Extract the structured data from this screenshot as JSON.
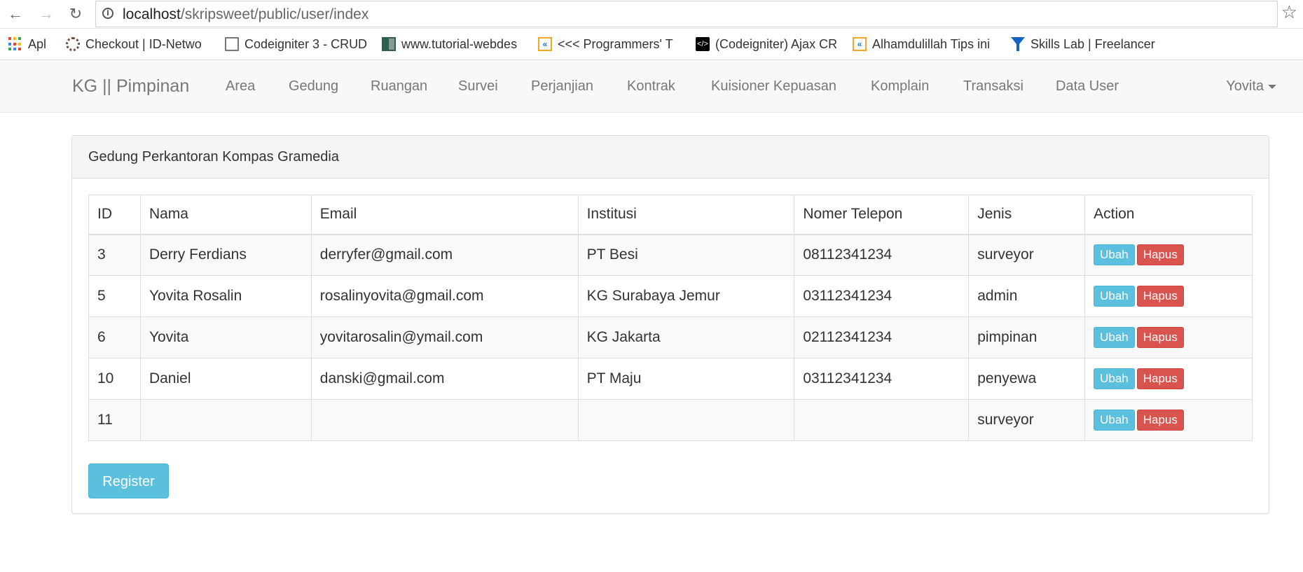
{
  "browser": {
    "url_host": "localhost",
    "url_path": "/skripsweet/public/user/index",
    "bookmarks": [
      {
        "label": "Apl",
        "icon": "apps-grid-icon"
      },
      {
        "label": "Checkout | ID-Netwo",
        "icon": "gear-icon"
      },
      {
        "label": "Codeigniter 3 - CRUD",
        "icon": "document-icon"
      },
      {
        "label": "www.tutorial-webdes",
        "icon": "site-grid-icon"
      },
      {
        "label": "<<< Programmers' T",
        "icon": "k-logo-icon"
      },
      {
        "label": "(Codeigniter) Ajax CR",
        "icon": "code-icon"
      },
      {
        "label": "Alhamdulillah Tips ini",
        "icon": "k-logo-icon"
      },
      {
        "label": "Skills Lab | Freelancer",
        "icon": "freelancer-icon"
      }
    ]
  },
  "navbar": {
    "brand": "KG || Pimpinan",
    "links": [
      "Area",
      "Gedung",
      "Ruangan",
      "Survei",
      "Perjanjian",
      "Kontrak",
      "Kuisioner Kepuasan",
      "Komplain",
      "Transaksi",
      "Data User"
    ],
    "user": "Yovita"
  },
  "panel": {
    "title": "Gedung Perkantoran Kompas Gramedia",
    "columns": [
      "ID",
      "Nama",
      "Email",
      "Institusi",
      "Nomer Telepon",
      "Jenis",
      "Action"
    ],
    "rows": [
      {
        "id": "3",
        "nama": "Derry Ferdians",
        "email": "derryfer@gmail.com",
        "institusi": "PT Besi",
        "telepon": "08112341234",
        "jenis": "surveyor"
      },
      {
        "id": "5",
        "nama": "Yovita Rosalin",
        "email": "rosalinyovita@gmail.com",
        "institusi": "KG Surabaya Jemur",
        "telepon": "03112341234",
        "jenis": "admin"
      },
      {
        "id": "6",
        "nama": "Yovita",
        "email": "yovitarosalin@ymail.com",
        "institusi": "KG Jakarta",
        "telepon": "02112341234",
        "jenis": "pimpinan"
      },
      {
        "id": "10",
        "nama": "Daniel",
        "email": "danski@gmail.com",
        "institusi": "PT Maju",
        "telepon": "03112341234",
        "jenis": "penyewa"
      },
      {
        "id": "11",
        "nama": "",
        "email": "",
        "institusi": "",
        "telepon": "",
        "jenis": "surveyor"
      }
    ],
    "edit_label": "Ubah",
    "delete_label": "Hapus",
    "register_label": "Register"
  },
  "colors": {
    "info": "#5bc0de",
    "danger": "#d9534f",
    "navbar_bg": "#f8f8f8"
  }
}
